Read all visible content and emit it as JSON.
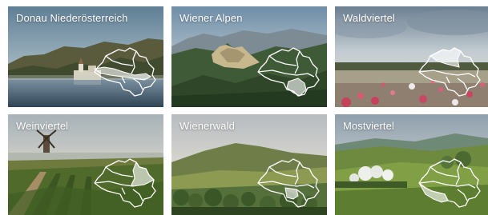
{
  "tiles": [
    {
      "title": "Donau Niederösterreich",
      "highlight": "donau"
    },
    {
      "title": "Wiener Alpen",
      "highlight": "alpen"
    },
    {
      "title": "Waldviertel",
      "highlight": "wald"
    },
    {
      "title": "Weinviertel",
      "highlight": "wein"
    },
    {
      "title": "Wienerwald",
      "highlight": "wienerwald"
    },
    {
      "title": "Mostviertel",
      "highlight": "most"
    }
  ],
  "colors": {
    "label": "#ffffff",
    "map_fill": "#ffffff"
  },
  "icons": [
    "lower-austria-map-icon"
  ]
}
